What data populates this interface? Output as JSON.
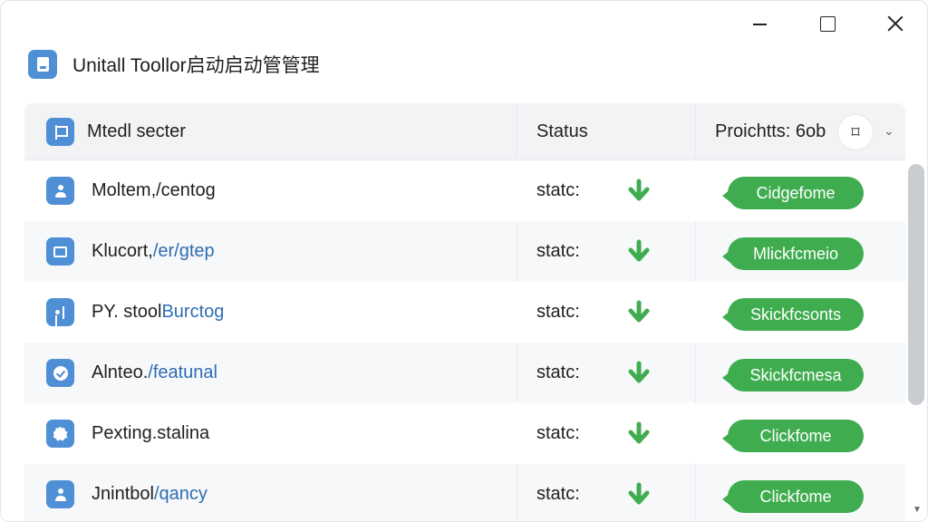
{
  "window": {
    "title": "Unitall Toollor启动启动管管理",
    "controls": {
      "minimize": "minimize",
      "maximize": "maximize",
      "close": "close"
    }
  },
  "table": {
    "headers": {
      "name": "Mtedl secter",
      "status": "Status",
      "processes": "Proichtts: 6ob"
    },
    "header_actions": {
      "crop": "⌑",
      "dropdown": "⌄"
    },
    "rows": [
      {
        "icon": "user-icon",
        "name": "Moltem,/centog",
        "path": "",
        "status": "statc:",
        "badge": "Cidgefome"
      },
      {
        "icon": "screen-icon",
        "name": "Klucort,",
        "path": "/er/gtep",
        "status": "statc:",
        "badge": "Mlickfcmeio"
      },
      {
        "icon": "document-person-icon",
        "name": "PY. stool ",
        "path": "Burctog",
        "status": "statc:",
        "badge": "Skickfcsonts"
      },
      {
        "icon": "shield-check-icon",
        "name": "Alnteo.",
        "path": "/featunal",
        "status": "statc:",
        "badge": "Skickfcmesa"
      },
      {
        "icon": "verified-badge-icon",
        "name": "Pexting.stalina",
        "path": "",
        "status": "statc:",
        "badge": "Clickfome"
      },
      {
        "icon": "user-icon",
        "name": "Jnintbol ",
        "path": "/qancy",
        "status": "statc:",
        "badge": "Clickfome"
      }
    ]
  },
  "colors": {
    "accent_blue": "#4f8fd6",
    "status_green": "#3fad4f",
    "link_blue": "#2f6db3"
  }
}
